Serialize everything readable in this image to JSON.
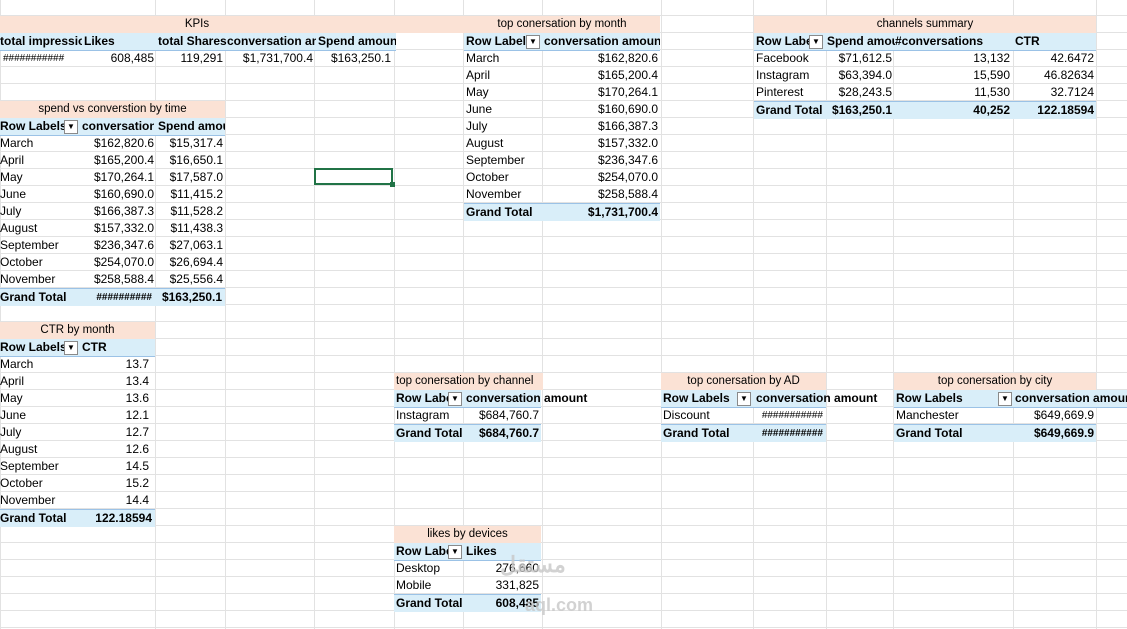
{
  "kpis": {
    "title": "KPIs",
    "headers": [
      "total impressio",
      "Likes",
      "total Shares",
      "conversation am",
      "Spend amount"
    ],
    "values": [
      "###########",
      "608,485",
      "119,291",
      "$1,731,700.4",
      "$163,250.1"
    ]
  },
  "spend_vs_conv": {
    "title": "spend vs converstion by time",
    "headers": [
      "Row Labels",
      "conversation",
      "Spend amount"
    ],
    "rows": [
      [
        "March",
        "$162,820.6",
        "$15,317.4"
      ],
      [
        "April",
        "$165,200.4",
        "$16,650.1"
      ],
      [
        "May",
        "$170,264.1",
        "$17,587.0"
      ],
      [
        "June",
        "$160,690.0",
        "$11,415.2"
      ],
      [
        "July",
        "$166,387.3",
        "$11,528.2"
      ],
      [
        "August",
        "$157,332.0",
        "$11,438.3"
      ],
      [
        "September",
        "$236,347.6",
        "$27,063.1"
      ],
      [
        "October",
        "$254,070.0",
        "$26,694.4"
      ],
      [
        "November",
        "$258,588.4",
        "$25,556.4"
      ]
    ],
    "total": [
      "Grand Total",
      "##########",
      "$163,250.1"
    ]
  },
  "ctr_month": {
    "title": "CTR by month",
    "headers": [
      "Row Labels",
      "CTR"
    ],
    "rows": [
      [
        "March",
        "13.7"
      ],
      [
        "April",
        "13.4"
      ],
      [
        "May",
        "13.6"
      ],
      [
        "June",
        "12.1"
      ],
      [
        "July",
        "12.7"
      ],
      [
        "August",
        "12.6"
      ],
      [
        "September",
        "14.5"
      ],
      [
        "October",
        "15.2"
      ],
      [
        "November",
        "14.4"
      ]
    ],
    "total": [
      "Grand Total",
      "122.18594"
    ]
  },
  "top_conv_month": {
    "title": "top conersation by month",
    "headers": [
      "Row Labels",
      "conversation amount"
    ],
    "rows": [
      [
        "March",
        "$162,820.6"
      ],
      [
        "April",
        "$165,200.4"
      ],
      [
        "May",
        "$170,264.1"
      ],
      [
        "June",
        "$160,690.0"
      ],
      [
        "July",
        "$166,387.3"
      ],
      [
        "August",
        "$157,332.0"
      ],
      [
        "September",
        "$236,347.6"
      ],
      [
        "October",
        "$254,070.0"
      ],
      [
        "November",
        "$258,588.4"
      ]
    ],
    "total": [
      "Grand Total",
      "$1,731,700.4"
    ]
  },
  "channels": {
    "title": "channels summary",
    "headers": [
      "Row Labe",
      "Spend amou",
      "#conversations",
      "CTR"
    ],
    "rows": [
      [
        "Facebook",
        "$71,612.5",
        "13,132",
        "42.6472"
      ],
      [
        "Instagram",
        "$63,394.0",
        "15,590",
        "46.82634"
      ],
      [
        "Pinterest",
        "$28,243.5",
        "11,530",
        "32.7124"
      ]
    ],
    "total": [
      "Grand Total",
      "$163,250.1",
      "40,252",
      "122.18594"
    ]
  },
  "top_conv_channel": {
    "title": "top conersation by channel",
    "headers": [
      "Row Labe",
      "conversation amount"
    ],
    "row": [
      "Instagram",
      "$684,760.7"
    ],
    "total": [
      "Grand Total",
      "$684,760.7"
    ]
  },
  "top_conv_ad": {
    "title": "top conersation by AD",
    "headers": [
      "Row Labels",
      "conversation amount"
    ],
    "row": [
      "Discount",
      "###########"
    ],
    "total": [
      "Grand Total",
      "###########"
    ]
  },
  "top_conv_city": {
    "title": "top conersation by city",
    "headers": [
      "Row Labels",
      "conversation amount"
    ],
    "row": [
      "Manchester",
      "$649,669.9"
    ],
    "total": [
      "Grand Total",
      "$649,669.9"
    ]
  },
  "likes_devices": {
    "title": "likes by devices",
    "headers": [
      "Row Labe",
      "Likes"
    ],
    "rows": [
      [
        "Desktop",
        "276,660"
      ],
      [
        "Mobile",
        "331,825"
      ]
    ],
    "total": [
      "Grand Total",
      "608,485"
    ]
  },
  "watermark": {
    "line1": "مستقل",
    "line2": "aql.com"
  }
}
